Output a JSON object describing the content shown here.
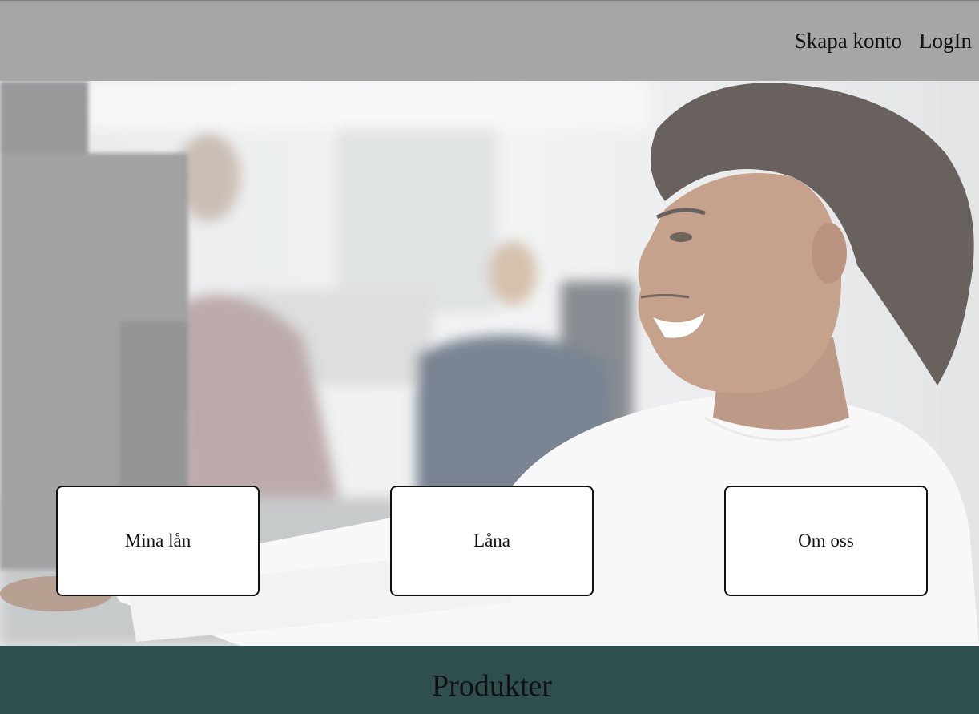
{
  "header": {
    "nav": {
      "create_account": "Skapa konto",
      "login": "LogIn"
    }
  },
  "hero": {
    "image_subject": "smiling young man at a computer in an office",
    "cards": {
      "my_loans": "Mina lån",
      "borrow": "Låna",
      "about_us": "Om oss"
    }
  },
  "products": {
    "title": "Produkter"
  },
  "colors": {
    "header_bg": "#a6a6a6",
    "footer_bg": "#2f4f4f",
    "card_bg": "#ffffff",
    "card_border": "#111111"
  }
}
